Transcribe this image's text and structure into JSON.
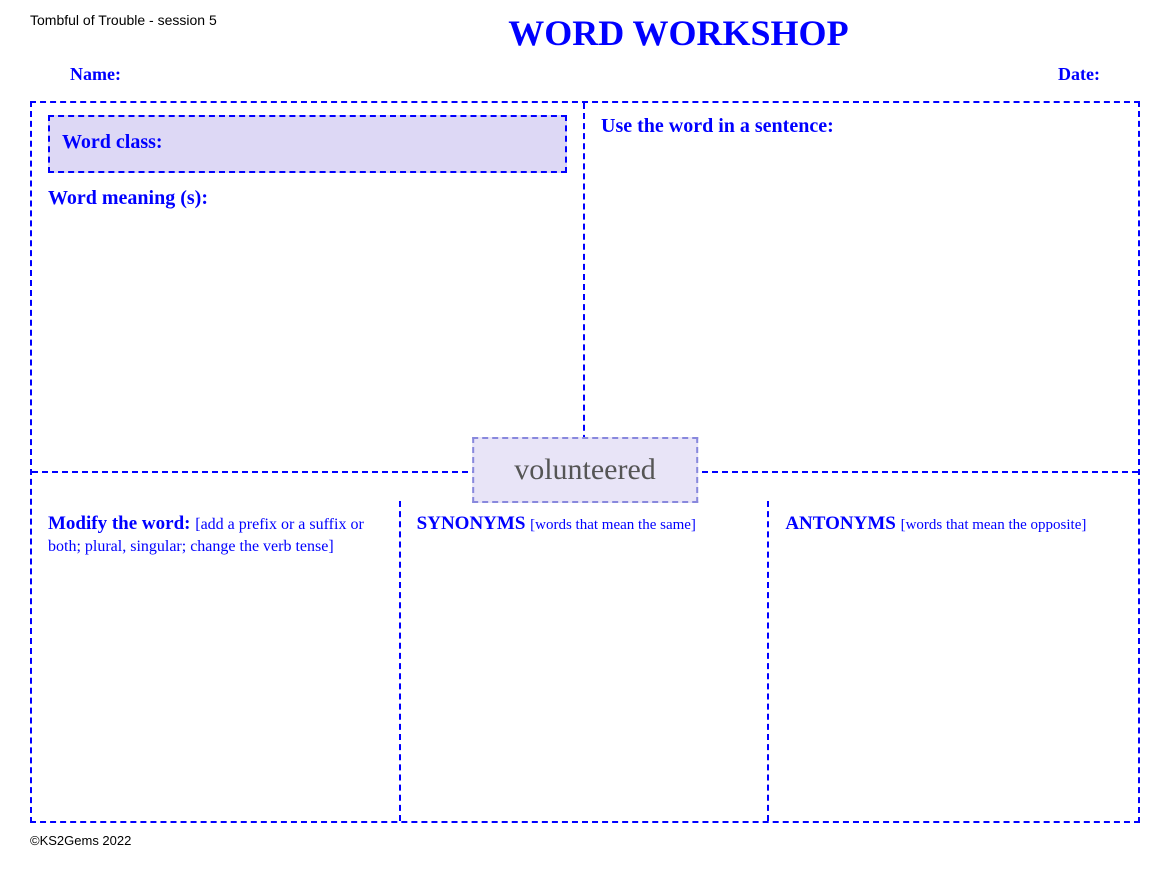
{
  "session_label": "Tombful of Trouble - session 5",
  "main_title": "WORD WORKSHOP",
  "name_label": "Name:",
  "date_label": "Date:",
  "word_class_label": "Word class:",
  "word_meaning_label": "Word meaning (s):",
  "use_in_sentence_label": "Use the word in a sentence:",
  "center_word": "volunteered",
  "modify_label": "Modify the word:",
  "modify_sub": "[add a prefix or a suffix or both; plural, singular; change the verb tense]",
  "synonyms_label": "SYNONYMS",
  "synonyms_sub": "[words that mean the same]",
  "antonyms_label": "ANTONYMS",
  "antonyms_sub": "[words that mean the opposite]",
  "footer": "©KS2Gems 2022"
}
